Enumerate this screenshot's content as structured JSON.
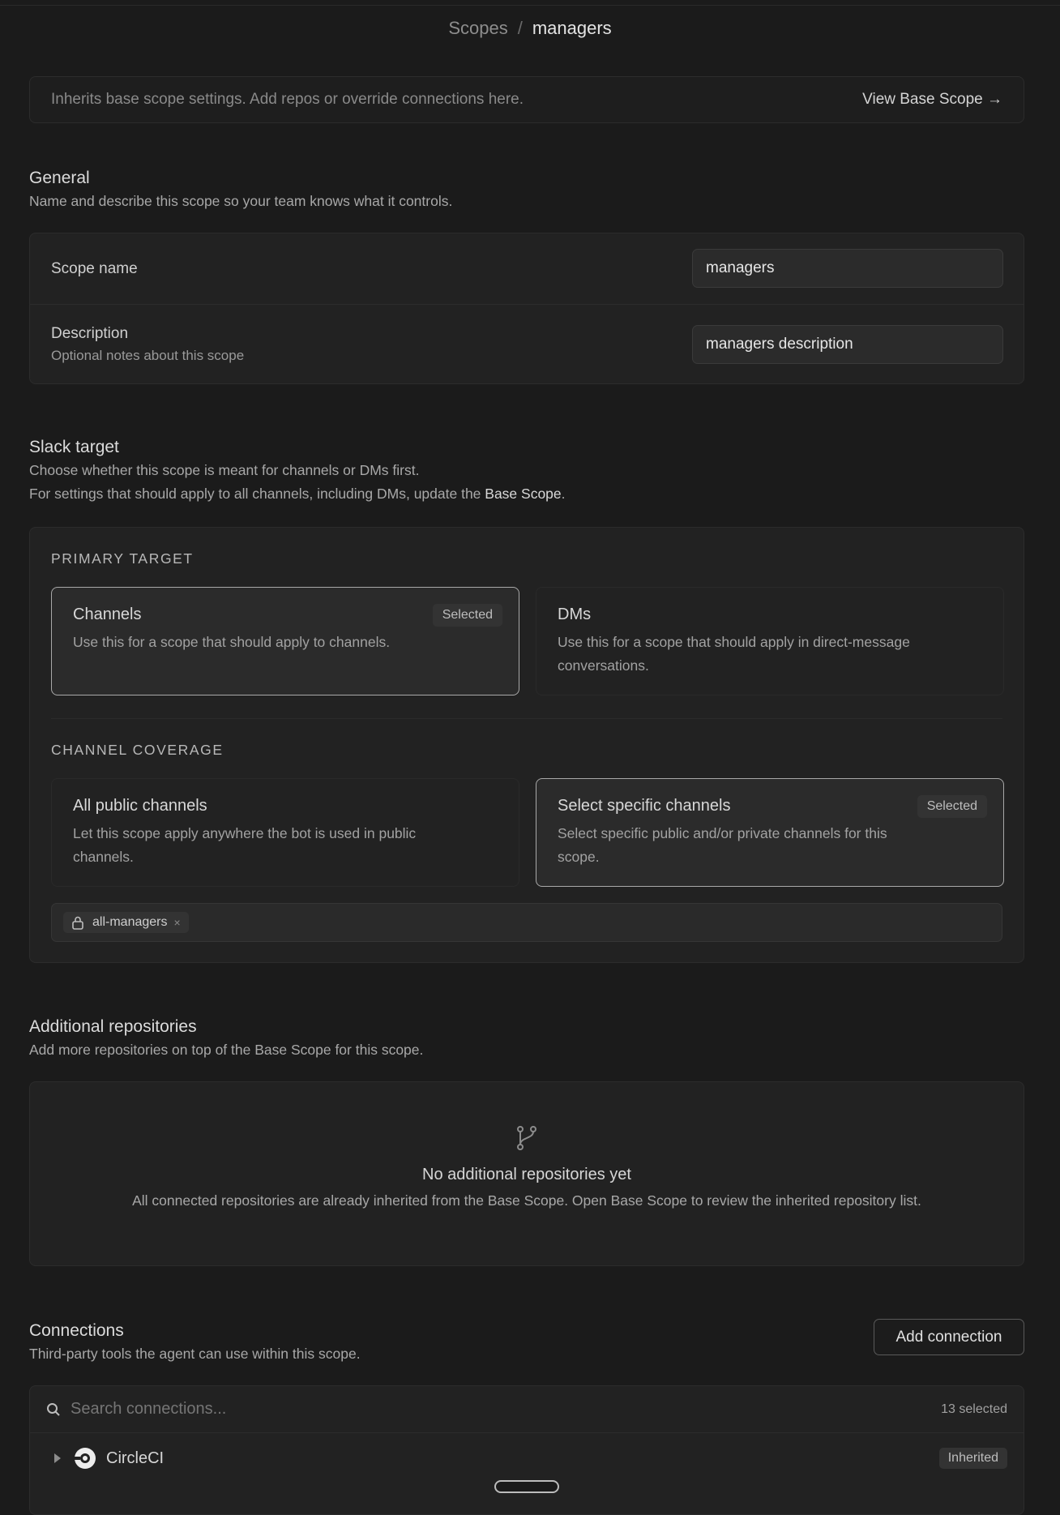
{
  "breadcrumb": {
    "parent": "Scopes",
    "separator": "/",
    "current": "managers"
  },
  "banner": {
    "info": "Inherits base scope settings. Add repos or override connections here.",
    "link": "View Base Scope →"
  },
  "general": {
    "title": "General",
    "description": "Name and describe this scope so your team knows what it controls.",
    "scope_name_label": "Scope name",
    "scope_name_value": "managers",
    "description_label": "Description",
    "description_sublabel": "Optional notes about this scope",
    "description_value": "managers description"
  },
  "slack": {
    "title": "Slack target",
    "description_line1": "Choose whether this scope is meant for channels or DMs first.",
    "description_line2_prefix": "For settings that should apply to all channels, including DMs, update the ",
    "description_line2_bold": "Base Scope",
    "description_line2_suffix": ".",
    "primary_heading": "PRIMARY TARGET",
    "primary_options": [
      {
        "title": "Channels",
        "desc": "Use this for a scope that should apply to channels.",
        "badge": "Selected"
      },
      {
        "title": "DMs",
        "desc": "Use this for a scope that should apply in direct-message conversations."
      }
    ],
    "coverage_heading": "CHANNEL COVERAGE",
    "coverage_options": [
      {
        "title": "All public channels",
        "desc": "Let this scope apply anywhere the bot is used in public channels."
      },
      {
        "title": "Select specific channels",
        "desc": "Select specific public and/or private channels for this scope.",
        "badge": "Selected"
      }
    ],
    "chips": [
      {
        "label": "all-managers",
        "remove": "×",
        "icon": "lock-icon"
      }
    ]
  },
  "repos": {
    "title": "Additional repositories",
    "description": "Add more repositories on top of the Base Scope for this scope.",
    "empty_icon": "git-branch-icon",
    "empty_title": "No additional repositories yet",
    "empty_desc": "All connected repositories are already inherited from the Base Scope. Open Base Scope to review the inherited repository list."
  },
  "connections": {
    "title": "Connections",
    "description": "Third-party tools the agent can use within this scope.",
    "add_button": "Add connection",
    "search_placeholder": "Search connections...",
    "selected_count": "13 selected",
    "items": [
      {
        "name": "CircleCI",
        "badge": "Inherited",
        "icon": "circleci-icon"
      }
    ]
  }
}
